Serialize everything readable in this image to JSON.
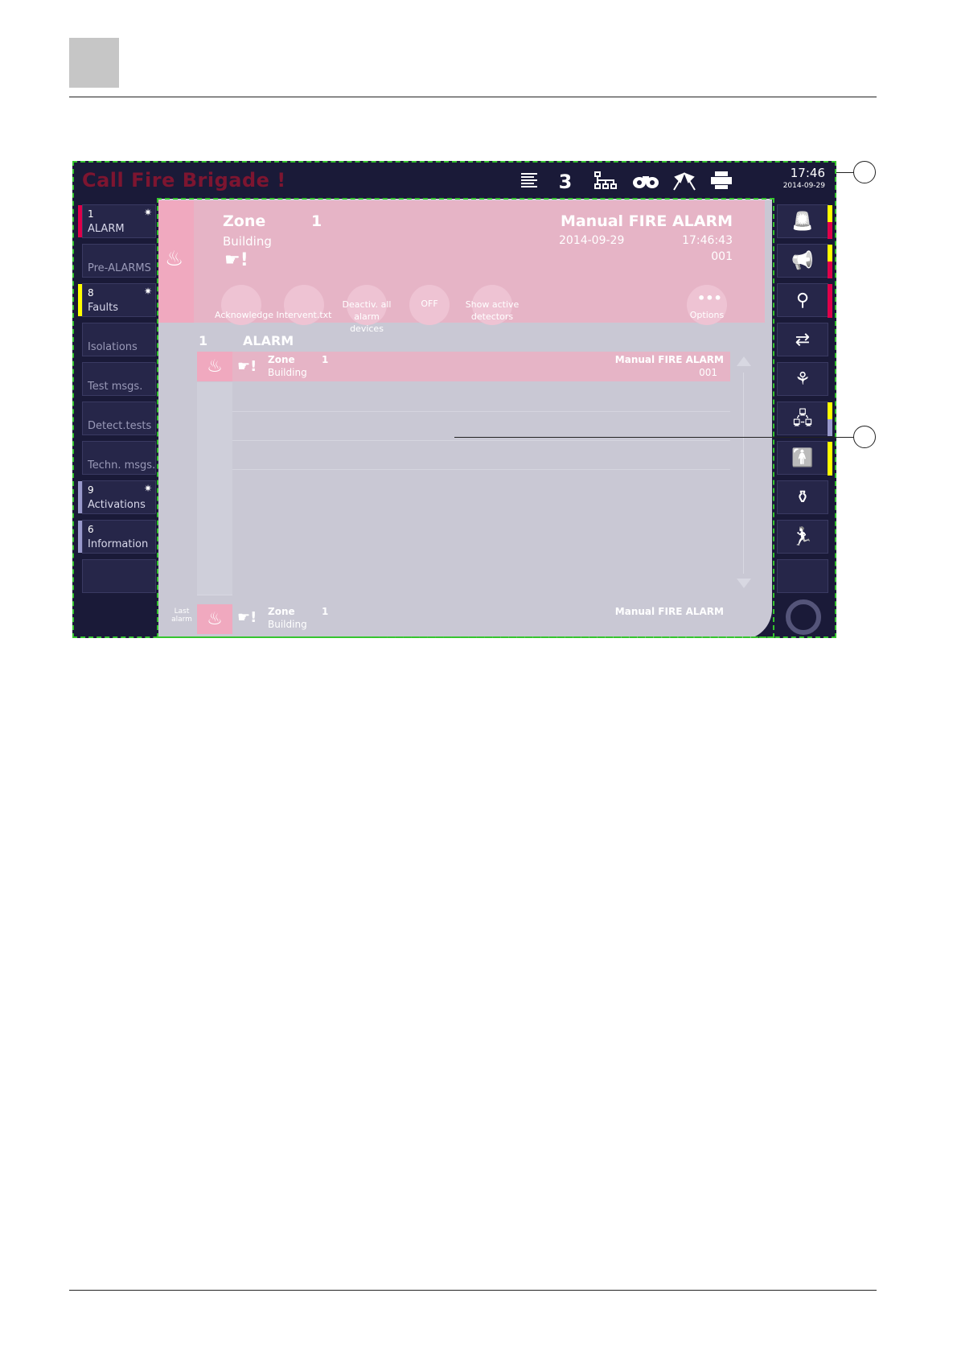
{
  "header": {
    "title": "Call Fire Brigade !",
    "count": "3",
    "time": "17:46",
    "date": "2014-09-29"
  },
  "left_sidebar": [
    {
      "count": "1",
      "label": "ALARM",
      "star": "✷",
      "strip_color": "#e0004a"
    },
    {
      "count": "",
      "label": "Pre-ALARMS",
      "star": "",
      "strip_color": ""
    },
    {
      "count": "8",
      "label": "Faults",
      "star": "✷",
      "strip_color": "#ffff00"
    },
    {
      "count": "",
      "label": "Isolations",
      "star": "",
      "strip_color": ""
    },
    {
      "count": "",
      "label": "Test msgs.",
      "star": "",
      "strip_color": ""
    },
    {
      "count": "",
      "label": "Detect.tests",
      "star": "",
      "strip_color": ""
    },
    {
      "count": "",
      "label": "Techn. msgs.",
      "star": "",
      "strip_color": ""
    },
    {
      "count": "9",
      "label": "Activations",
      "star": "✷",
      "strip_color": "#9999cc"
    },
    {
      "count": "6",
      "label": "Information",
      "star": "",
      "strip_color": "#9999cc"
    },
    {
      "count": "",
      "label": "",
      "star": "",
      "strip_color": ""
    }
  ],
  "right_sidebar": [
    {
      "icon": "siren-icon",
      "glyph": "🚨",
      "strips": [
        "#ffff00",
        "#e0004a"
      ]
    },
    {
      "icon": "horn-icon",
      "glyph": "📢",
      "strips": [
        "#ffff00",
        "#e0004a"
      ]
    },
    {
      "icon": "detector-icon",
      "glyph": "⚲",
      "strips": [
        "#e0004a"
      ]
    },
    {
      "icon": "sensor-icon",
      "glyph": "⇄",
      "strips": []
    },
    {
      "icon": "loop-icon",
      "glyph": "⚘",
      "strips": []
    },
    {
      "icon": "network-icon",
      "glyph": "🖧",
      "strips": [
        "#ffff00",
        "#9999cc"
      ]
    },
    {
      "icon": "person-info-icon",
      "glyph": "🚹",
      "strips": [
        "#ffff00"
      ]
    },
    {
      "icon": "extinguisher-icon",
      "glyph": "⚱",
      "strips": []
    },
    {
      "icon": "evacuation-icon",
      "glyph": "🏃",
      "strips": []
    },
    {
      "icon": "blank-icon",
      "glyph": "",
      "strips": []
    }
  ],
  "zone_detail": {
    "zone_label": "Zone",
    "zone_number": "1",
    "building": "Building",
    "alarm_type": "Manual FIRE ALARM",
    "date": "2014-09-29",
    "time": "17:46:43",
    "element": "001",
    "buttons": [
      {
        "label": "Acknowledge"
      },
      {
        "label": "Intervent.txt"
      },
      {
        "label": "Deactiv. all alarm devices"
      },
      {
        "label": "OFF"
      },
      {
        "label": "Show active detectors"
      },
      {
        "label": "Options"
      }
    ]
  },
  "alarm_list": {
    "count": "1",
    "title": "ALARM",
    "rows": [
      {
        "zone_label": "Zone",
        "zone_number": "1",
        "building": "Building",
        "alarm_type": "Manual FIRE ALARM",
        "element": "001"
      }
    ]
  },
  "last_alarm": {
    "label": "Last alarm",
    "zone_label": "Zone",
    "zone_number": "1",
    "building": "Building",
    "alarm_type": "Manual FIRE ALARM"
  },
  "colors": {
    "alarm_red": "#e0004a",
    "fault_yellow": "#ffff00",
    "info_purple": "#9999cc",
    "zone_pink": "#e6b4c6"
  }
}
